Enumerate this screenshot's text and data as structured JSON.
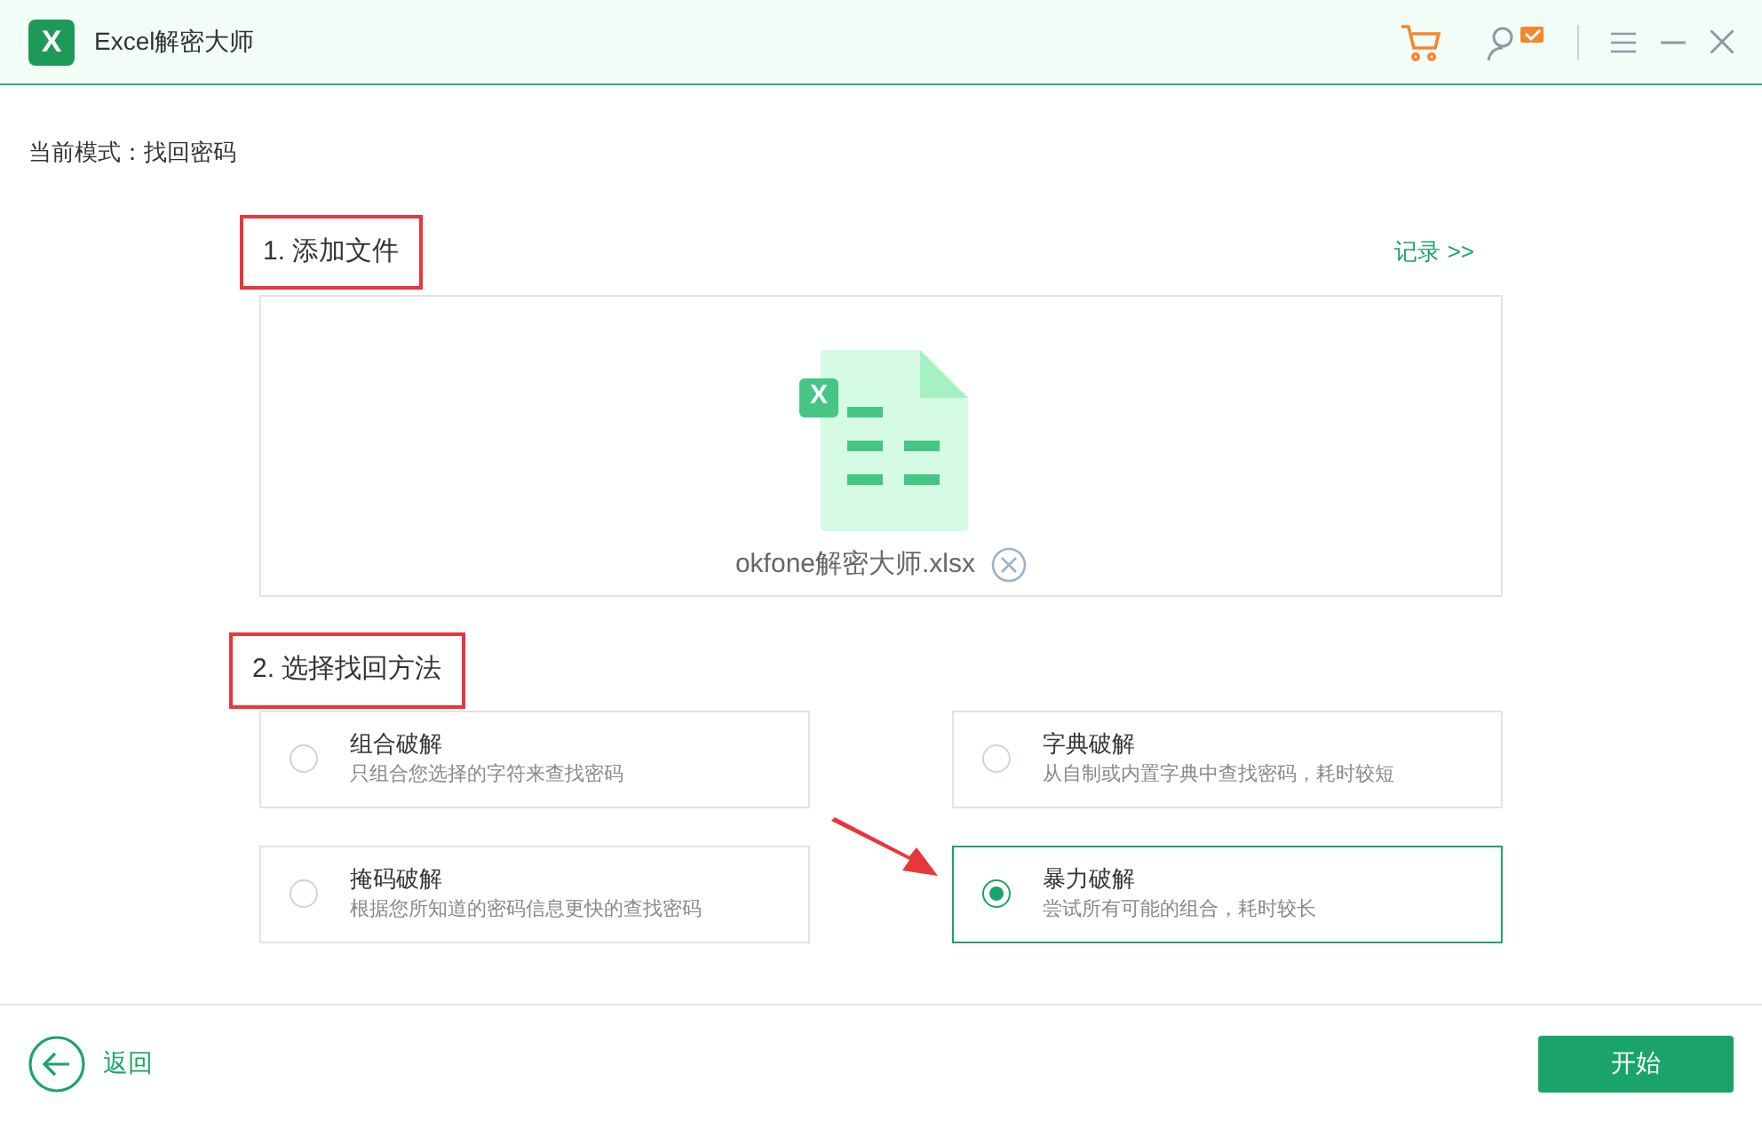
{
  "window": {
    "logo": "X",
    "title": "Excel解密大师"
  },
  "mode_label": "当前模式：找回密码",
  "step1": {
    "heading": "1. 添加文件",
    "highlighted": true,
    "history_link": "记录 >>",
    "file": {
      "badge": "X",
      "name": "okfone解密大师.xlsx"
    }
  },
  "step2": {
    "heading": "2. 选择找回方法",
    "highlighted": true,
    "methods": [
      {
        "title": "组合破解",
        "desc": "只组合您选择的字符来查找密码",
        "selected": false
      },
      {
        "title": "字典破解",
        "desc": "从自制或内置字典中查找密码，耗时较短",
        "selected": false
      },
      {
        "title": "掩码破解",
        "desc": "根据您所知道的密码信息更快的查找密码",
        "selected": false
      },
      {
        "title": "暴力破解",
        "desc": "尝试所有可能的组合，耗时较长",
        "selected": true
      }
    ]
  },
  "footer": {
    "back": "返回",
    "start": "开始"
  }
}
